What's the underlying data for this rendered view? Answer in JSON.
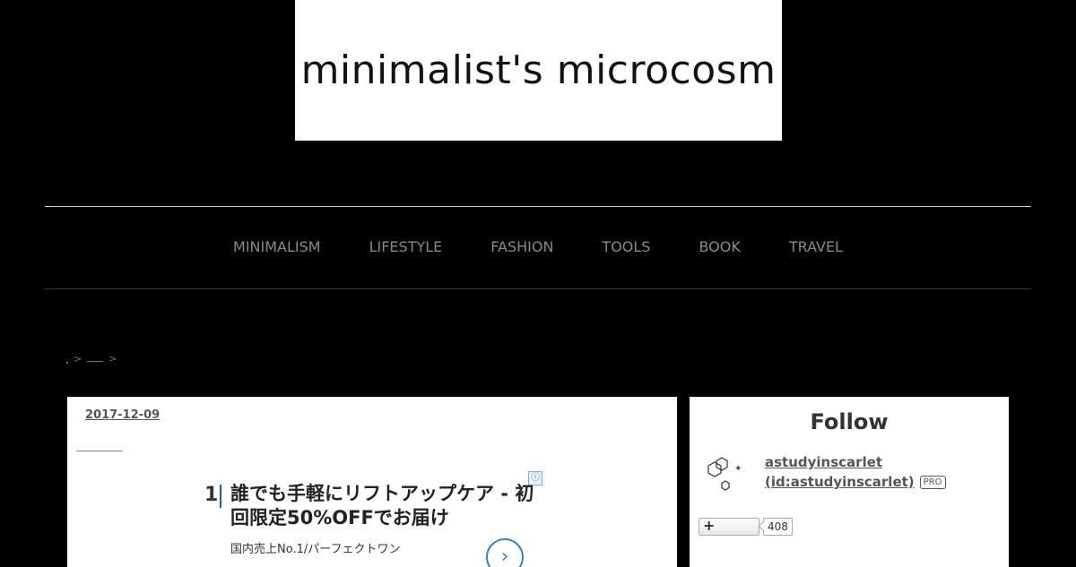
{
  "site": {
    "title": "minimalist's microcosm"
  },
  "nav": [
    "MINIMALISM",
    "LIFESTYLE",
    "FASHION",
    "TOOLS",
    "BOOK",
    "TRAVEL"
  ],
  "breadcrumb": {
    "sep1": ">",
    "sep2": ">"
  },
  "article": {
    "date": "2017-12-09"
  },
  "ad": {
    "number": "1",
    "headline": "誰でも手軽にリフトアップケア - 初回限定50%OFFでお届け",
    "subtext": "国内売上No.1/パーフェクトワン",
    "info_glyph": "ⓘ",
    "arrow_glyph": "›"
  },
  "sidebar": {
    "title": "Follow",
    "username": "astudyinscarlet",
    "user_id": "(id:astudyinscarlet)",
    "badge": "PRO",
    "follow_glyph": "+",
    "follower_count": "408",
    "avatar_icon": "hexagon-molecule-icon"
  }
}
